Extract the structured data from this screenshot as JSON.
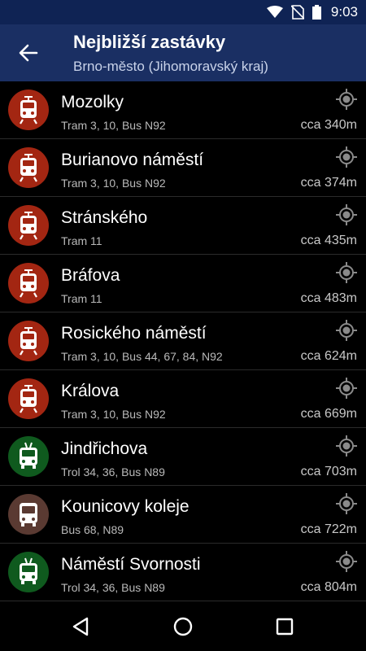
{
  "status": {
    "time": "9:03",
    "icons": [
      "wifi-icon",
      "no-sim-icon",
      "battery-icon"
    ]
  },
  "header": {
    "title": "Nejbližší zastávky",
    "subtitle": "Brno-město (Jihomoravský kraj)",
    "back_icon": "arrow-back-icon"
  },
  "colors": {
    "statusbar": "#0f2354",
    "appbar": "#1a2f63",
    "tram": "#a32612",
    "trolleybus": "#0f5a1e",
    "bus": "#5a3a32"
  },
  "stops": [
    {
      "name": "Mozolky",
      "lines": "Tram 3, 10, Bus N92",
      "distance": "cca 340m",
      "type": "tram"
    },
    {
      "name": "Burianovo náměstí",
      "lines": "Tram 3, 10, Bus N92",
      "distance": "cca 374m",
      "type": "tram"
    },
    {
      "name": "Stránského",
      "lines": "Tram 11",
      "distance": "cca 435m",
      "type": "tram"
    },
    {
      "name": "Bráfova",
      "lines": "Tram 11",
      "distance": "cca 483m",
      "type": "tram"
    },
    {
      "name": "Rosického náměstí",
      "lines": "Tram 3, 10, Bus 44, 67, 84, N92",
      "distance": "cca 624m",
      "type": "tram"
    },
    {
      "name": "Králova",
      "lines": "Tram 3, 10, Bus N92",
      "distance": "cca 669m",
      "type": "tram"
    },
    {
      "name": "Jindřichova",
      "lines": "Trol 34, 36, Bus N89",
      "distance": "cca 703m",
      "type": "trolleybus"
    },
    {
      "name": "Kounicovy koleje",
      "lines": "Bus 68, N89",
      "distance": "cca 722m",
      "type": "bus"
    },
    {
      "name": "Náměstí Svornosti",
      "lines": "Trol 34, 36, Bus N89",
      "distance": "cca 804m",
      "type": "trolleybus"
    }
  ],
  "navbar": {
    "icons": [
      "back-triangle-icon",
      "home-circle-icon",
      "recents-square-icon"
    ]
  }
}
